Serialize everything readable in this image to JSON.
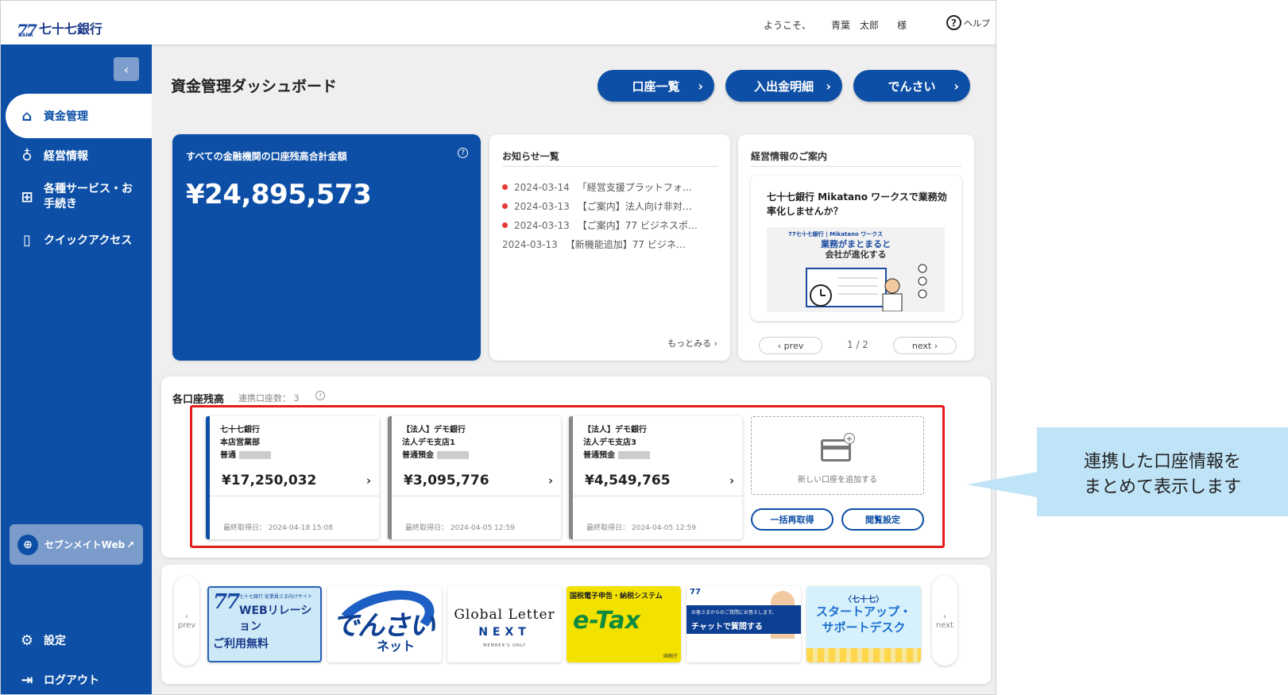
{
  "header": {
    "logo_number": "77",
    "logo_sub": "BANK",
    "logo_name": "七十七銀行",
    "welcome": "ようこそ、",
    "user_name": "青葉　太郎",
    "honorific": "様",
    "help": "ヘルプ"
  },
  "sidebar": {
    "collapse_icon": "chevron-left-icon",
    "items": [
      {
        "label": "資金管理",
        "icon": "home-icon"
      },
      {
        "label": "経営情報",
        "icon": "lightbulb-icon"
      },
      {
        "label": "各種サービス・お\n手続き",
        "icon": "apps-icon"
      },
      {
        "label": "クイックアクセス",
        "icon": "bookmark-icon"
      }
    ],
    "sevenmate": "セブンメイトWeb",
    "settings": "設定",
    "logout": "ログアウト"
  },
  "main": {
    "title": "資金管理ダッシュボード",
    "buttons": [
      "口座一覧",
      "入出金明細",
      "でんさい"
    ]
  },
  "total": {
    "label": "すべての金融機関の口座残高合計金額",
    "amount": "¥24,895,573"
  },
  "news": {
    "title": "お知らせ一覧",
    "items": [
      {
        "date": "2024-03-14",
        "text": "「経営支援プラットフォ…",
        "unread": true
      },
      {
        "date": "2024-03-13",
        "text": "【ご案内】法人向け非対…",
        "unread": true
      },
      {
        "date": "2024-03-13",
        "text": "【ご案内】77 ビジネスポ…",
        "unread": true
      },
      {
        "date": "2024-03-13",
        "text": "【新機能追加】77 ビジネ…",
        "unread": false
      }
    ],
    "more": "もっとみる ›"
  },
  "info": {
    "title": "経営情報のご案内",
    "card_title": "七十七銀行 Mikatano ワークスで業務効率化しませんか？",
    "banner_top": "77七十七銀行 | Mikatano ワークス",
    "banner_line1": "業務がまとまると",
    "banner_line2": "会社が進化する",
    "prev": "‹  prev",
    "next": "next  ›",
    "pager": "1 / 2"
  },
  "accounts": {
    "title": "各口座残高",
    "count": "連携口座数： 3",
    "list": [
      {
        "bank": "七十七銀行",
        "branch": "本店営業部",
        "type": "普通",
        "balance": "¥17,250,032",
        "updated": "最終取得日： 2024-04-18 15:08"
      },
      {
        "bank": "【法人】デモ銀行",
        "branch": "法人デモ支店1",
        "type": "普通預金",
        "balance": "¥3,095,776",
        "updated": "最終取得日： 2024-04-05 12:59"
      },
      {
        "bank": "【法人】デモ銀行",
        "branch": "法人デモ支店3",
        "type": "普通預金",
        "balance": "¥4,549,765",
        "updated": "最終取得日： 2024-04-05 12:59"
      }
    ],
    "add": "新しい口座を追加する",
    "refresh": "一括再取得",
    "view_settings": "閲覧設定"
  },
  "carousel": {
    "prev": "prev",
    "next": "next",
    "tiles": {
      "web_a": "77",
      "web_b": "七十七銀行 従業員さま向けサイト",
      "web_c": "WEBリレーション",
      "web_d": "ご利用無料",
      "den_a": "でんさい",
      "den_b": "ネット",
      "gl_a": "Global Letter",
      "gl_b": "NEXT",
      "gl_c": "MEMBER'S ONLY",
      "tax_a": "国税電子申告・納税システム",
      "tax_b": "e-Tax",
      "tax_c": "国税庁",
      "chat_a": "77",
      "chat_b": "お客さまからのご質問にお答えします。",
      "chat_c": "チャットで質問する",
      "su_a": "〈七十七〉",
      "su_b": "スタートアップ・\nサポートデスク"
    }
  },
  "callout": "連携した口座情報を\nまとめて表示します"
}
